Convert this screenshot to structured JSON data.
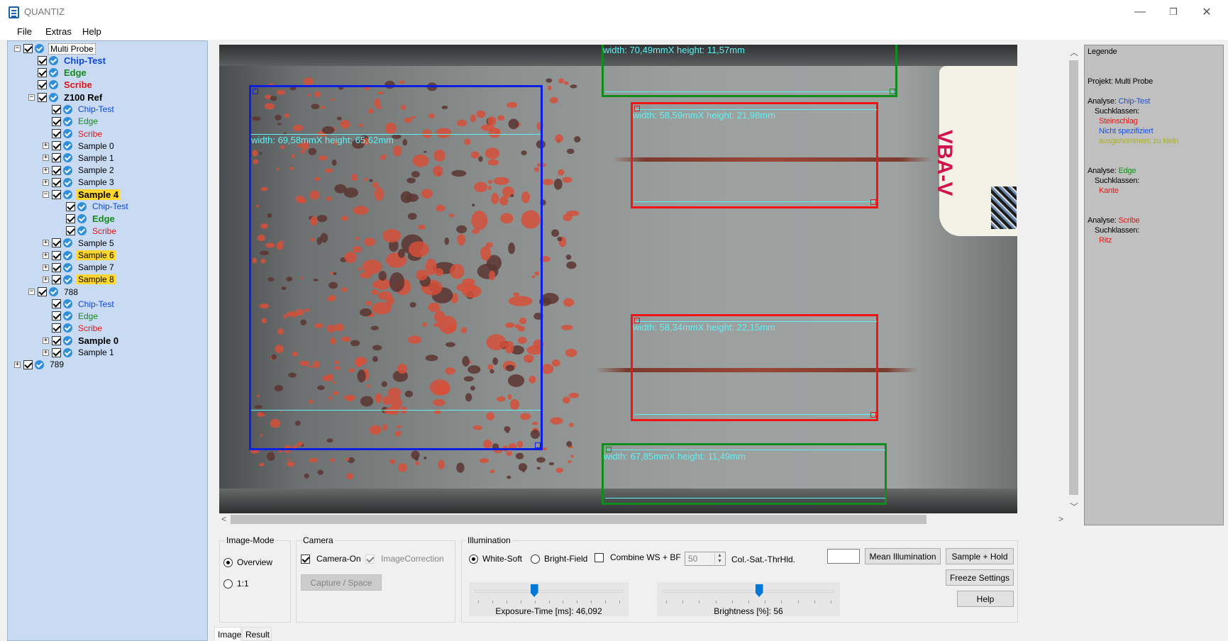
{
  "window": {
    "title": "QUANTIZ",
    "minimize_glyph": "—",
    "restore_glyph": "❐",
    "close_glyph": "✕"
  },
  "menu": [
    "File",
    "Extras",
    "Help"
  ],
  "tree": [
    {
      "label": "Multi Probe",
      "color": "c-black",
      "bold": false,
      "level": 0,
      "expander": "−",
      "style": "sel"
    },
    {
      "label": "Chip-Test",
      "color": "c-blue",
      "bold": true,
      "level": 1
    },
    {
      "label": "Edge",
      "color": "c-green",
      "bold": true,
      "level": 1
    },
    {
      "label": "Scribe",
      "color": "c-red",
      "bold": true,
      "level": 1
    },
    {
      "label": "Z100 Ref",
      "color": "c-black",
      "bold": true,
      "level": 1,
      "expander": "−"
    },
    {
      "label": "Chip-Test",
      "color": "c-blue",
      "bold": false,
      "level": 2
    },
    {
      "label": "Edge",
      "color": "c-green",
      "bold": false,
      "level": 2
    },
    {
      "label": "Scribe",
      "color": "c-red",
      "bold": false,
      "level": 2
    },
    {
      "label": "Sample 0",
      "color": "c-black",
      "bold": false,
      "level": 2,
      "expander": "+"
    },
    {
      "label": "Sample 1",
      "color": "c-black",
      "bold": false,
      "level": 2,
      "expander": "+"
    },
    {
      "label": "Sample 2",
      "color": "c-black",
      "bold": false,
      "level": 2,
      "expander": "+"
    },
    {
      "label": "Sample 3",
      "color": "c-black",
      "bold": false,
      "level": 2,
      "expander": "+"
    },
    {
      "label": "Sample 4",
      "color": "c-black",
      "bold": true,
      "level": 2,
      "expander": "−",
      "style": "hl"
    },
    {
      "label": "Chip-Test",
      "color": "c-blue",
      "bold": false,
      "level": 3
    },
    {
      "label": "Edge",
      "color": "c-green",
      "bold": true,
      "level": 3
    },
    {
      "label": "Scribe",
      "color": "c-red",
      "bold": false,
      "level": 3
    },
    {
      "label": "Sample 5",
      "color": "c-black",
      "bold": false,
      "level": 2,
      "expander": "+"
    },
    {
      "label": "Sample 6",
      "color": "c-black",
      "bold": false,
      "level": 2,
      "expander": "+",
      "style": "hl"
    },
    {
      "label": "Sample 7",
      "color": "c-black",
      "bold": false,
      "level": 2,
      "expander": "+"
    },
    {
      "label": "Sample 8",
      "color": "c-black",
      "bold": false,
      "level": 2,
      "expander": "+",
      "style": "hl"
    },
    {
      "label": "788",
      "color": "c-black",
      "bold": false,
      "level": 1,
      "expander": "−"
    },
    {
      "label": "Chip-Test",
      "color": "c-blue",
      "bold": false,
      "level": 2
    },
    {
      "label": "Edge",
      "color": "c-green",
      "bold": false,
      "level": 2
    },
    {
      "label": "Scribe",
      "color": "c-red",
      "bold": false,
      "level": 2
    },
    {
      "label": "Sample 0",
      "color": "c-black",
      "bold": true,
      "level": 2,
      "expander": "+"
    },
    {
      "label": "Sample 1",
      "color": "c-black",
      "bold": false,
      "level": 2,
      "expander": "+"
    },
    {
      "label": "789",
      "color": "c-black",
      "bold": false,
      "level": 0,
      "expander": "+"
    }
  ],
  "image": {
    "roi_blue": {
      "label": "width: 69,58mmX height: 65,62mm"
    },
    "roi_red_top": {
      "label": "width: 58,59mmX height: 21,98mm"
    },
    "roi_red_bottom": {
      "label": "width: 58,34mmX height: 22,15mm"
    },
    "roi_green_top": {
      "label": "width: 70,49mmX height: 11,57mm"
    },
    "roi_green_bottom": {
      "label": "width: 67,85mmX height: 11,49mm"
    },
    "sticker_text": "VBA-V"
  },
  "legend": {
    "title": "Legende",
    "project": "Projekt: Multi Probe",
    "analysis_prefix": "Analyse: ",
    "classes_label": "Suchklassen:",
    "analyses": [
      {
        "name": "Chip-Test",
        "name_color": "c-lblue",
        "classes": [
          {
            "text": "Steinschlag",
            "color": "c-red"
          },
          {
            "text": "Nicht spezifiziert",
            "color": "c-lblue"
          },
          {
            "text": "ausgenommen: zu klein",
            "color": "c-yellowgreen"
          }
        ]
      },
      {
        "name": "Edge",
        "name_color": "c-green",
        "classes": [
          {
            "text": "Kante",
            "color": "c-red"
          }
        ]
      },
      {
        "name": "Scribe",
        "name_color": "c-red",
        "classes": [
          {
            "text": "Ritz",
            "color": "c-red"
          }
        ]
      }
    ]
  },
  "image_mode": {
    "title": "Image-Mode",
    "overview": "Overview",
    "one_to_one": "1:1",
    "selected": "overview"
  },
  "camera": {
    "title": "Camera",
    "camera_on": "Camera-On",
    "image_correction": "ImageCorrection",
    "capture": "Capture / Space"
  },
  "illumination": {
    "title": "Illumination",
    "white_soft": "White-Soft",
    "bright_field": "Bright-Field",
    "combine": "Combine WS + BF",
    "threshold_value": "50",
    "threshold_label": "Col.-Sat.-ThrHld.",
    "exposure_caption": "Exposure-Time [ms]: 46,092",
    "exposure_fraction": 0.4,
    "brightness_caption": "Brightness [%]: 56",
    "brightness_fraction": 0.56
  },
  "buttons": {
    "mean_illumination": "Mean Illumination",
    "sample_hold": "Sample + Hold",
    "freeze": "Freeze Settings",
    "help": "Help"
  },
  "tabs": [
    "Image",
    "Result"
  ]
}
